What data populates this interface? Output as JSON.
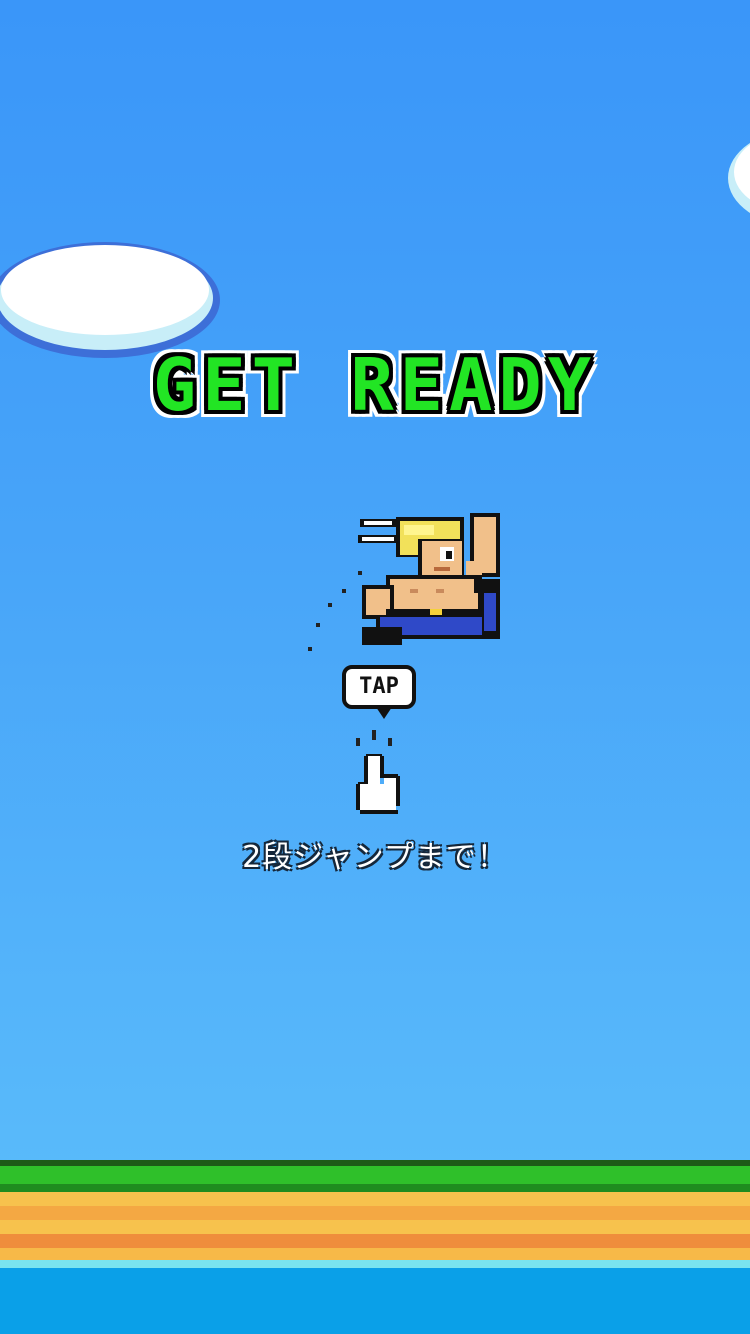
{
  "screen": {
    "title": "GET READY",
    "tap_label": "TAP",
    "hint": "2段ジャンプまで！"
  },
  "colors": {
    "sky_top": "#3a96f9",
    "sky_bottom": "#5cbdfb",
    "title_fill": "#22e524",
    "grass": "#2fc02a",
    "sand": "#f4a843",
    "water": "#0aa0e8"
  },
  "icons": [
    "cloud",
    "hero-character",
    "tap-speech-bubble",
    "pointing-hand-icon"
  ]
}
